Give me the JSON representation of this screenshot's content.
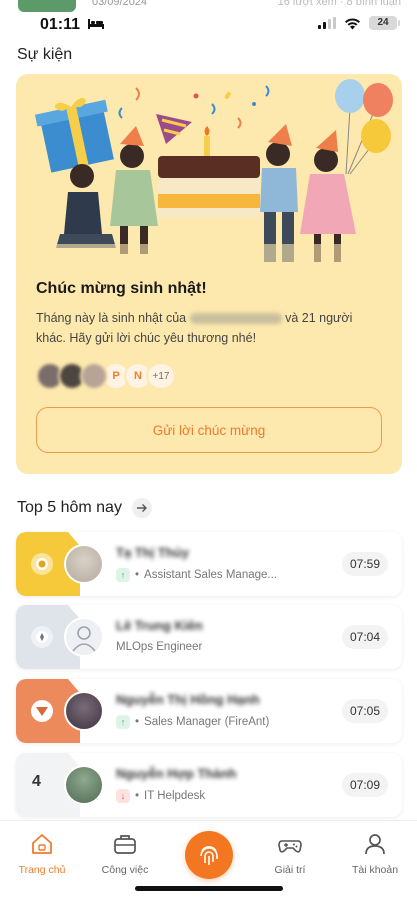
{
  "status_bar": {
    "time": "01:11",
    "battery": "24",
    "prev_date": "03/09/2024",
    "prev_right": "16 lượt xem · 8 bình luận"
  },
  "events": {
    "section_title": "Sự kiện",
    "card": {
      "heading": "Chúc mừng sinh nhật!",
      "desc_before": "Tháng này là sinh nhật của",
      "desc_after": "và 21 người khác. Hãy gửi lời chúc yêu thương nhé!",
      "avatar_letters": [
        "P",
        "N"
      ],
      "more_count": "+17",
      "button_label": "Gửi lời chúc mừng"
    }
  },
  "top5": {
    "title": "Top 5 hôm nay",
    "rows": [
      {
        "rank": "1",
        "name": "Tạ Thị Thủy",
        "role": "Assistant Sales Manage...",
        "time": "07:59",
        "trend": "up"
      },
      {
        "rank": "2",
        "name": "Lê Trung Kiên",
        "role": "MLOps Engineer",
        "time": "07:04",
        "trend": "none"
      },
      {
        "rank": "3",
        "name": "Nguyễn Thị Hồng Hạnh",
        "role": "Sales Manager (FireAnt)",
        "time": "07:05",
        "trend": "up"
      },
      {
        "rank": "4",
        "name": "Nguyễn Hợp Thành",
        "role": "IT Helpdesk",
        "time": "07:09",
        "trend": "down"
      }
    ]
  },
  "tab_bar": {
    "tabs": [
      {
        "label": "Trang chủ",
        "icon": "home-icon",
        "active": true
      },
      {
        "label": "Công việc",
        "icon": "briefcase-icon",
        "active": false
      },
      {
        "label": "Giải trí",
        "icon": "gamepad-icon",
        "active": false
      },
      {
        "label": "Tài khoản",
        "icon": "user-icon",
        "active": false
      }
    ],
    "center_icon": "fingerprint-icon"
  },
  "colors": {
    "accent": "#f37621",
    "card_bg": "#fde9ae",
    "gold": "#f6c93a",
    "silver": "#dfe3ea",
    "bronze": "#ec8a5c"
  }
}
